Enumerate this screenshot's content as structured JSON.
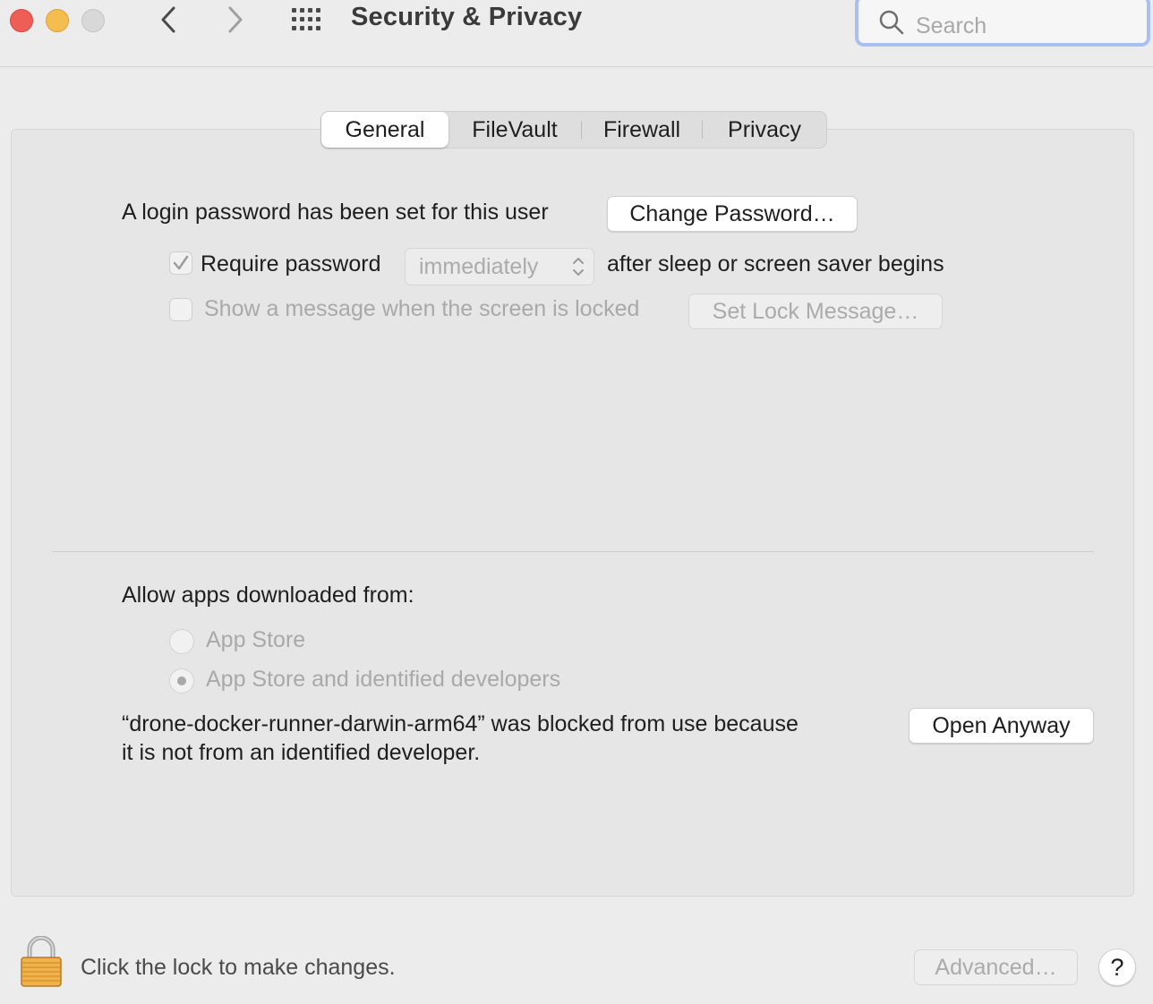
{
  "window": {
    "title": "Security & Privacy",
    "search_placeholder": "Search"
  },
  "tabs": [
    {
      "label": "General",
      "selected": true
    },
    {
      "label": "FileVault",
      "selected": false
    },
    {
      "label": "Firewall",
      "selected": false
    },
    {
      "label": "Privacy",
      "selected": false
    }
  ],
  "general": {
    "login_text": "A login password has been set for this user",
    "change_password_label": "Change Password…",
    "require_password": {
      "label": "Require password",
      "checked": true,
      "delay_value": "immediately",
      "suffix": "after sleep or screen saver begins"
    },
    "show_message": {
      "label": "Show a message when the screen is locked",
      "checked": false,
      "button_label": "Set Lock Message…"
    }
  },
  "gatekeeper": {
    "heading": "Allow apps downloaded from:",
    "options": [
      {
        "label": "App Store",
        "selected": false
      },
      {
        "label": "App Store and identified developers",
        "selected": true
      }
    ],
    "blocked_line1": "“drone-docker-runner-darwin-arm64” was blocked from use because",
    "blocked_line2": "it is not from an identified developer.",
    "open_anyway_label": "Open Anyway"
  },
  "footer": {
    "lock_text": "Click the lock to make changes.",
    "advanced_label": "Advanced…",
    "help_label": "?"
  },
  "icons": {
    "back": "chevron-left-icon",
    "forward": "chevron-right-icon",
    "grid": "grid-icon",
    "search": "search-icon",
    "lock": "lock-icon",
    "checkmark": "checkmark-icon",
    "select_arrows": "updown-chevron-icon"
  },
  "colors": {
    "close": "#ee5e57",
    "minimize": "#f5bd4f",
    "maximize": "#d8d8d8",
    "search_focus_ring": "#a9bff0"
  }
}
